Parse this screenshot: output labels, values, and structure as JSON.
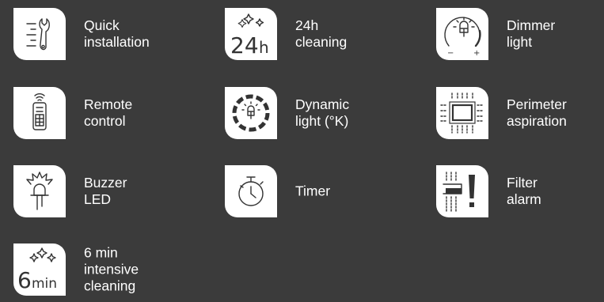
{
  "features": [
    {
      "icon": "wrench-icon",
      "line1": "Quick",
      "line2": "installation",
      "line3": ""
    },
    {
      "icon": "24h-icon",
      "line1": "24h",
      "line2": "cleaning",
      "line3": ""
    },
    {
      "icon": "dimmer-icon",
      "line1": "Dimmer",
      "line2": "light",
      "line3": ""
    },
    {
      "icon": "remote-icon",
      "line1": "Remote",
      "line2": "control",
      "line3": ""
    },
    {
      "icon": "dynamic-light-icon",
      "line1": "Dynamic",
      "line2": "light (°K)",
      "line3": ""
    },
    {
      "icon": "perimeter-icon",
      "line1": "Perimeter",
      "line2": "aspiration",
      "line3": ""
    },
    {
      "icon": "buzzer-led-icon",
      "line1": "Buzzer",
      "line2": "LED",
      "line3": ""
    },
    {
      "icon": "timer-icon",
      "line1": "Timer",
      "line2": "",
      "line3": ""
    },
    {
      "icon": "filter-alarm-icon",
      "line1": "Filter",
      "line2": "alarm",
      "line3": ""
    },
    {
      "icon": "6min-icon",
      "line1": "6 min",
      "line2": "intensive",
      "line3": "cleaning"
    }
  ],
  "icon_text": {
    "h24_number": "24",
    "h24_unit": "h",
    "min_number": "6",
    "min_unit": "min",
    "dimmer_minus": "−",
    "dimmer_plus": "+"
  }
}
